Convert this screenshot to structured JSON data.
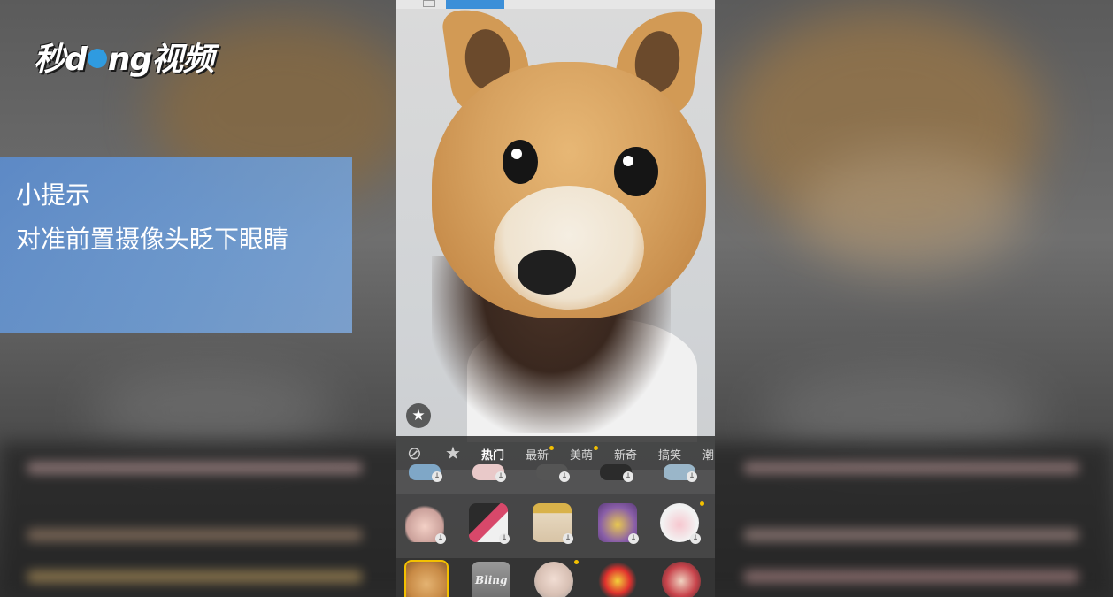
{
  "brand": {
    "logo_text_a": "秒d",
    "logo_text_b": "ng视频"
  },
  "tip": {
    "title": "小提示",
    "body": "对准前置摄像头眨下眼睛"
  },
  "colors": {
    "accent": "#f3c000",
    "panel": "#282828",
    "tip": "#5c8ccd",
    "selected_border": "#f3c000"
  },
  "phone": {
    "favorite_icon": "star-icon",
    "tabs": [
      {
        "icon": "no-effect-icon",
        "glyph": "⃠"
      },
      {
        "icon": "star-icon",
        "glyph": "★"
      },
      {
        "label": "热门",
        "active": true
      },
      {
        "label": "最新",
        "dot": true
      },
      {
        "label": "美萌",
        "dot": true
      },
      {
        "label": "新奇"
      },
      {
        "label": "搞笑"
      },
      {
        "label": "潮"
      }
    ],
    "tab_glyphs": {
      "none": "⊘",
      "star": "★"
    },
    "stickers_row2": [
      {
        "name": "hands-hearts-sticker"
      },
      {
        "name": "lipstick-sticker"
      },
      {
        "name": "gift-box-sticker"
      },
      {
        "name": "sparkle-frame-sticker"
      },
      {
        "name": "pig-hood-sticker",
        "new": true
      }
    ],
    "stickers_row3": [
      {
        "name": "shiba-dog-sticker",
        "selected": true
      },
      {
        "name": "bling-sticker",
        "label": "Bling"
      },
      {
        "name": "old-man-sticker",
        "new": true
      },
      {
        "name": "burst-sticker"
      },
      {
        "name": "clown-sticker"
      }
    ],
    "download_glyph": "↓",
    "star_glyph": "★"
  }
}
